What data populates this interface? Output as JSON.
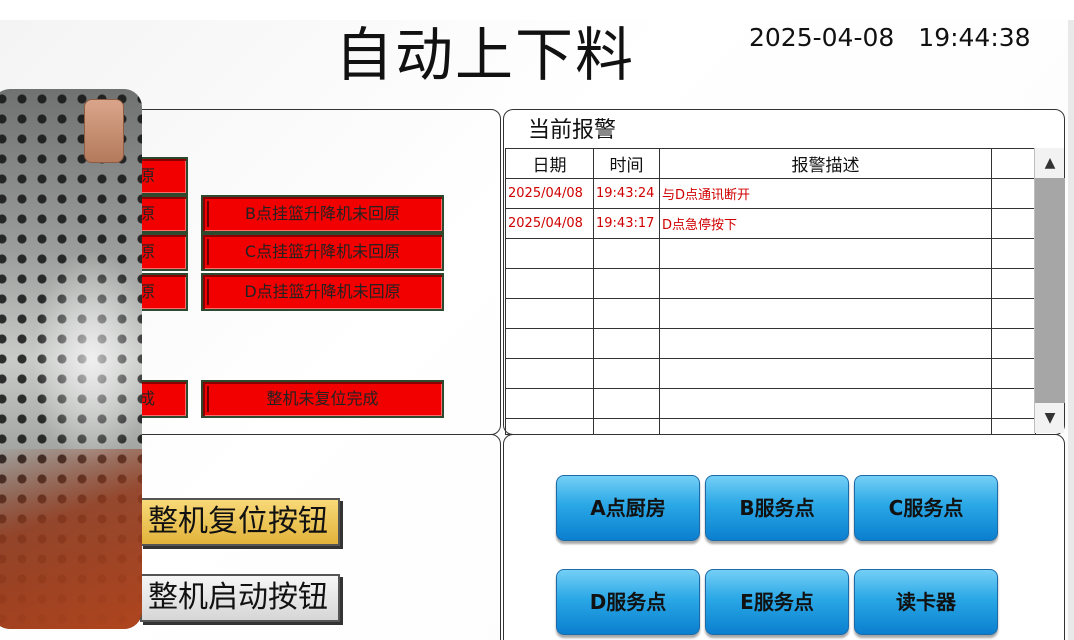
{
  "header": {
    "title": "自动上下料",
    "date": "2025-04-08",
    "time": "19:44:38"
  },
  "status_panel": {
    "alarm_lamps": [
      {
        "label": "原"
      },
      {
        "label": "原"
      },
      {
        "label": "原"
      },
      {
        "label": "原"
      },
      {
        "label": "B点挂篮升降机未回原"
      },
      {
        "label": "C点挂篮升降机未回原"
      },
      {
        "label": "D点挂篮升降机未回原"
      },
      {
        "label": "成"
      },
      {
        "label": "整机未复位完成"
      }
    ]
  },
  "controls": {
    "reset_label": "整机复位按钮",
    "start_label": "整机启动按钮"
  },
  "alarm_panel": {
    "title": "当前报警",
    "columns": [
      "日期",
      "时间",
      "报警描述"
    ],
    "rows": [
      {
        "date": "2025/04/08",
        "time": "19:43:24",
        "desc": "与D点通讯断开"
      },
      {
        "date": "2025/04/08",
        "time": "19:43:17",
        "desc": "D点急停按下"
      }
    ],
    "scroll_up_icon": "▲",
    "scroll_down_icon": "▼"
  },
  "navigation": {
    "buttons": [
      {
        "label": "A点厨房"
      },
      {
        "label": "B服务点"
      },
      {
        "label": "C服务点"
      },
      {
        "label": "D服务点"
      },
      {
        "label": "E服务点"
      },
      {
        "label": "读卡器"
      }
    ]
  },
  "colors": {
    "alarm_red": "#f20000",
    "alarm_text_red": "#d00000",
    "reset_button_gold": "#e2b33a",
    "nav_button_blue": "#2aa8e6"
  }
}
